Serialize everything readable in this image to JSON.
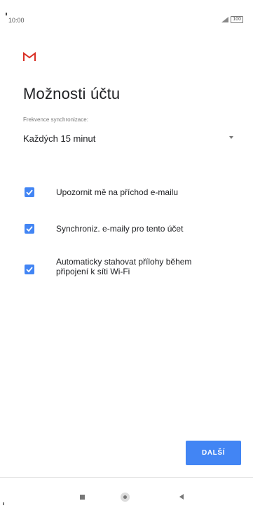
{
  "status_bar": {
    "time": "10:00",
    "battery": "100",
    "icons": [
      "signal-icon",
      "battery-icon"
    ]
  },
  "app": {
    "logo": "gmail-icon",
    "accent": "#4285f4",
    "logo_color": "#d93025"
  },
  "page": {
    "title": "Možnosti účtu",
    "sync_label": "Frekvence synchronizace:",
    "sync_value": "Každých 15 minut"
  },
  "options": [
    {
      "label": "Upozornit mě na příchod e-mailu",
      "checked": true
    },
    {
      "label": "Synchroniz. e-maily pro tento účet",
      "checked": true
    },
    {
      "label": "Automaticky stahovat přílohy během připojení k síti Wi-Fi",
      "checked": true
    }
  ],
  "footer": {
    "next_label": "DALŠÍ"
  },
  "nav": {
    "icons": [
      "recent-apps-icon",
      "home-icon",
      "back-icon"
    ]
  }
}
